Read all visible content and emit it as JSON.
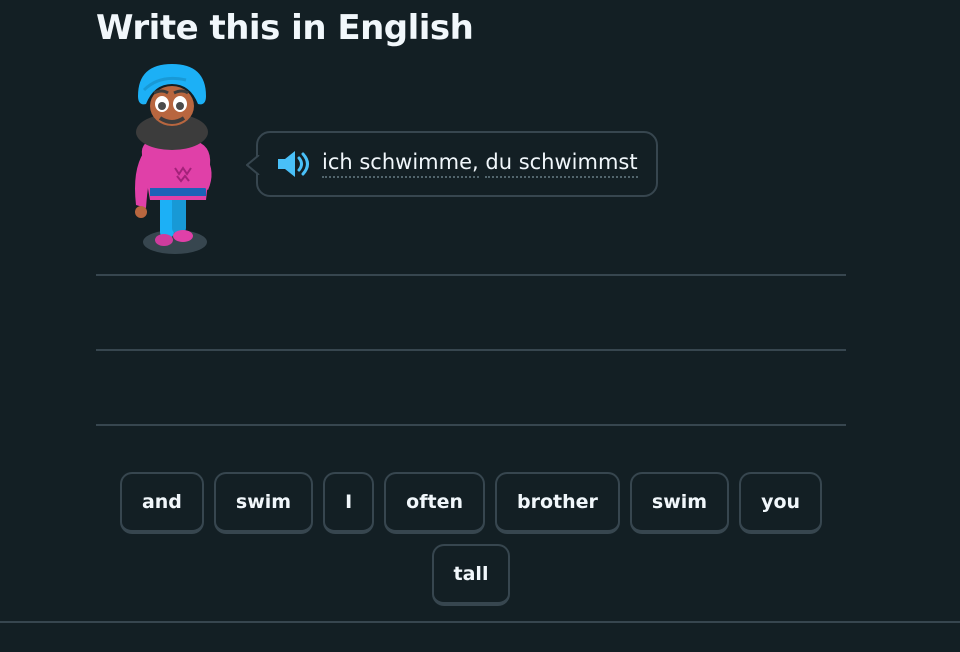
{
  "header": {
    "title": "Write this in English"
  },
  "prompt": {
    "tokens": [
      "ich schwimme,",
      "du schwimmst"
    ],
    "speaker_icon": "speaker-icon"
  },
  "word_bank": {
    "tiles": [
      "and",
      "swim",
      "I",
      "often",
      "brother",
      "swim",
      "you",
      "tall"
    ]
  },
  "colors": {
    "background": "#131f24",
    "border": "#37464f",
    "text": "#f1f7fb",
    "speaker": "#49c0f8"
  }
}
